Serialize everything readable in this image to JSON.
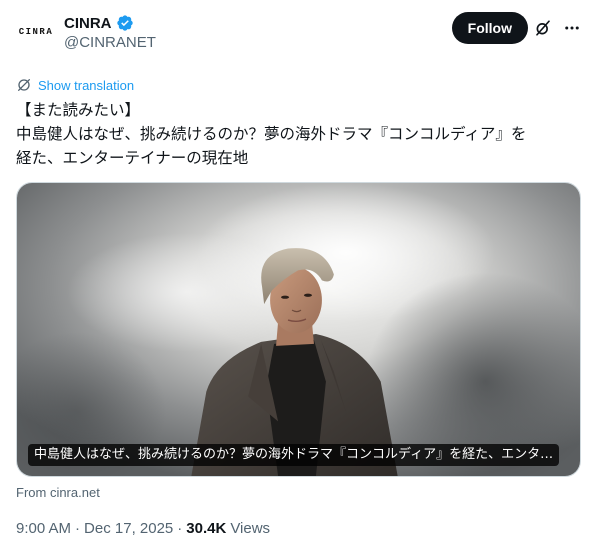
{
  "author": {
    "avatar_text": "CINRA",
    "display_name": "CINRA",
    "handle": "@CINRANET"
  },
  "actions": {
    "follow_label": "Follow"
  },
  "translate": {
    "label": "Show translation"
  },
  "tweet": {
    "lines": [
      "【また読みたい】",
      "中島健人はなぜ、挑み続けるのか？夢の海外ドラマ『コンコルディア』を",
      "経た、エンターテイナーの現在地"
    ]
  },
  "card": {
    "caption": "中島健人はなぜ、挑み続けるのか？夢の海外ドラマ『コンコルディア』を経た、エンタ…",
    "source": "From cinra.net"
  },
  "meta": {
    "time": "9:00 AM",
    "separator1": "·",
    "date": "Dec 17, 2025",
    "separator2": "·",
    "views_count": "30.4K",
    "views_label": "Views"
  },
  "colors": {
    "accent": "#1d9bf0",
    "text": "#0f1419",
    "muted": "#536471",
    "follow_bg": "#0f1419"
  },
  "icons": {
    "verified": "verified-badge-icon",
    "grok": "grok-icon",
    "more": "more-icon",
    "translate": "translate-icon"
  }
}
